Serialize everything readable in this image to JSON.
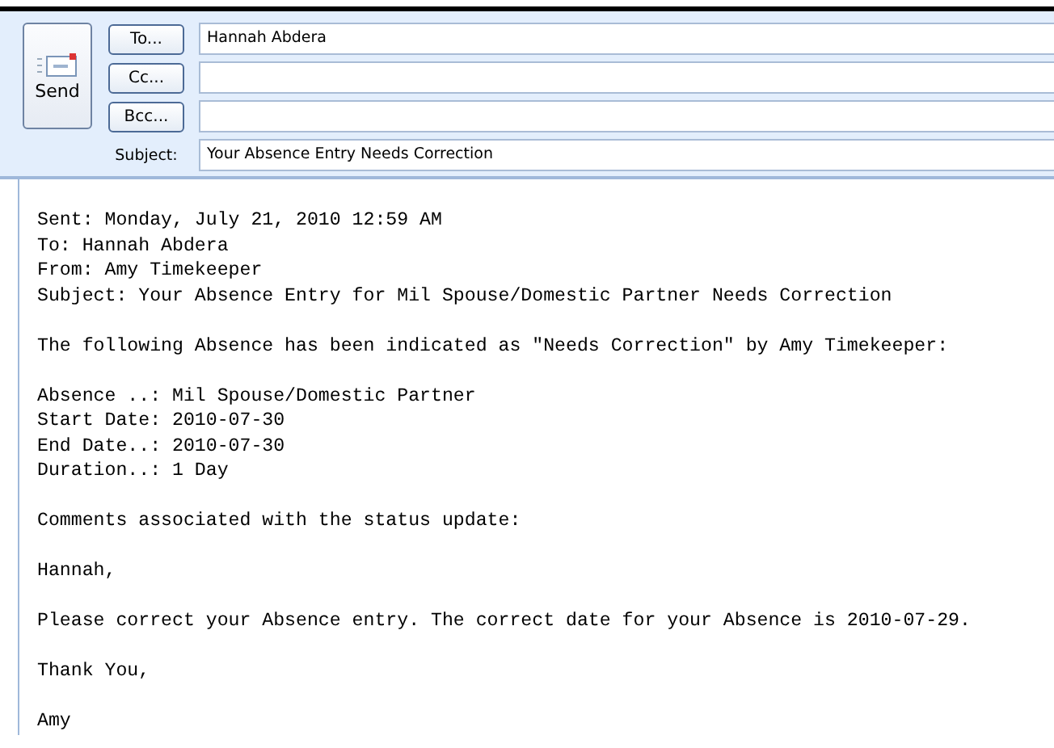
{
  "send_button": {
    "label": "Send"
  },
  "address_fields": [
    {
      "button": "To...",
      "value": "Hannah Abdera"
    },
    {
      "button": "Cc..."
    },
    {
      "button": "Bcc..."
    }
  ],
  "subject": {
    "label": "Subject:",
    "value": "Your Absence Entry Needs Correction"
  },
  "body": [
    [
      "Sent: Monday, July 21, 2010 12:59 AM",
      "To: Hannah Abdera",
      "From: Amy Timekeeper",
      "Subject: Your Absence Entry for Mil Spouse/Domestic Partner Needs Correction"
    ],
    [
      "The following Absence has been indicated as \"Needs Correction\" by Amy Timekeeper:"
    ],
    [
      "Absence ..: Mil Spouse/Domestic Partner",
      "Start Date: 2010-07-30",
      "End Date..: 2010-07-30",
      "Duration..: 1 Day"
    ],
    [
      "Comments associated with the status update:"
    ],
    [
      "Hannah,"
    ],
    [
      "Please correct your Absence entry. The correct date for your Absence is 2010-07-29."
    ],
    [
      "Thank You,"
    ],
    [
      "Amy"
    ]
  ]
}
